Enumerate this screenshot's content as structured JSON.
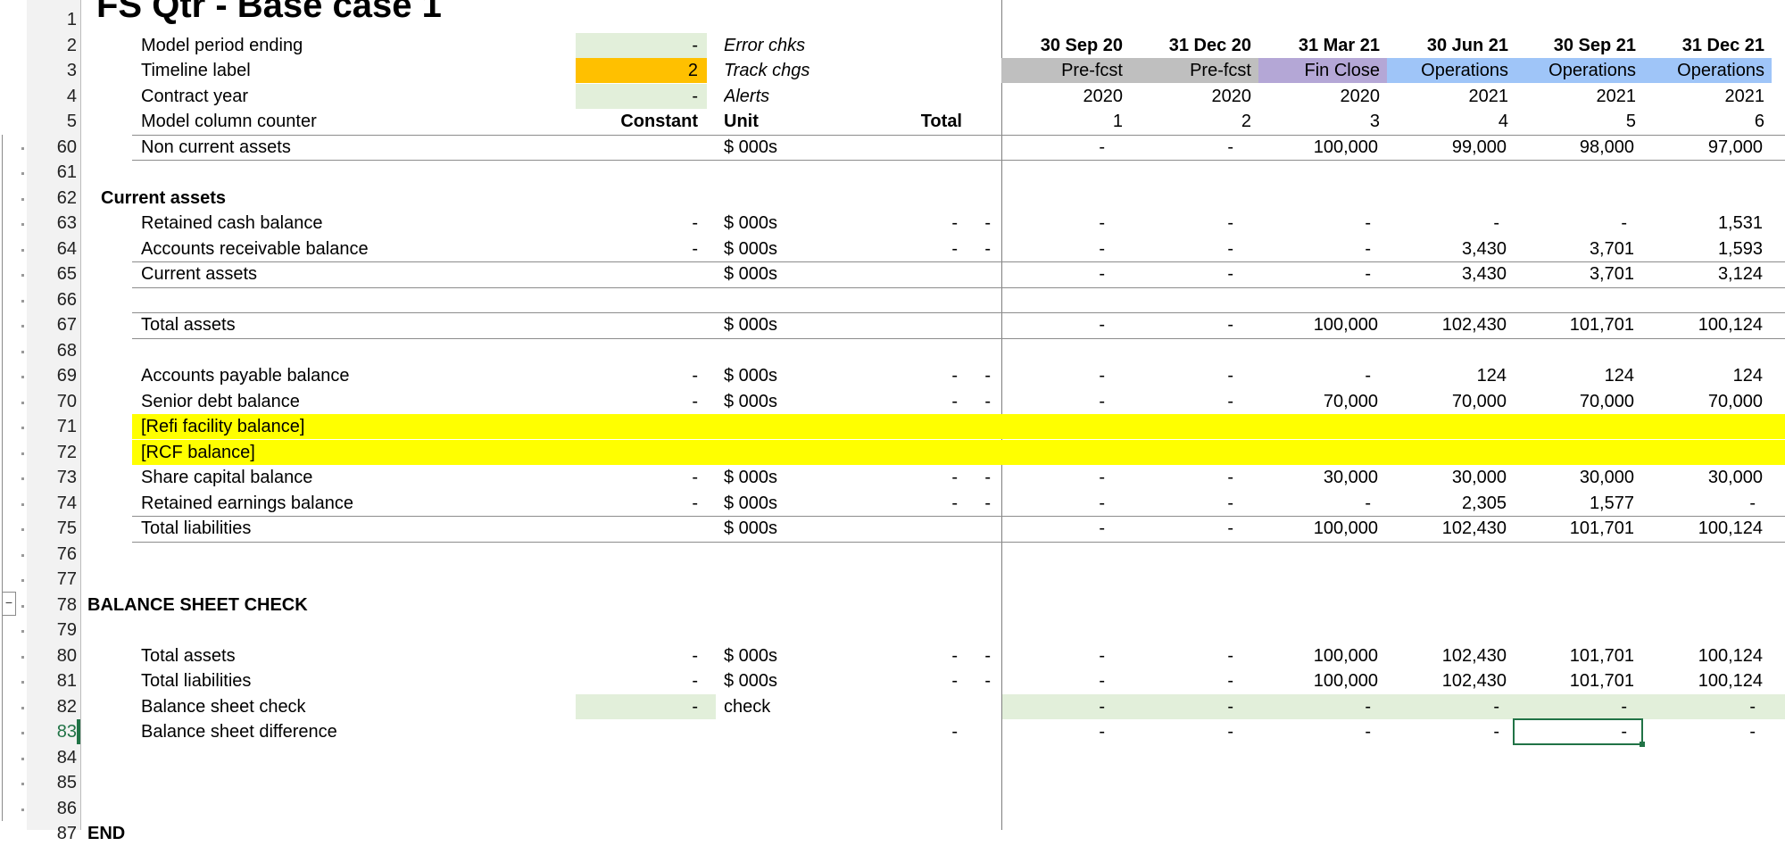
{
  "title": "FS Qtr - Base case 1",
  "header_rows": [
    {
      "row": "2",
      "label": "Model period ending",
      "constant": "-",
      "unit": "Error chks",
      "unit_italic": true,
      "periods": [
        "30 Sep 20",
        "31 Dec 20",
        "31 Mar 21",
        "30 Jun 21",
        "30 Sep 21",
        "31 Dec 21"
      ],
      "bold_periods": true
    },
    {
      "row": "3",
      "label": "Timeline label",
      "constant": "2",
      "unit": "Track chgs",
      "unit_italic": true,
      "periods": [
        "Pre-fcst",
        "Pre-fcst",
        "Fin Close",
        "Operations",
        "Operations",
        "Operations"
      ]
    },
    {
      "row": "4",
      "label": "Contract year",
      "constant": "-",
      "unit": "Alerts",
      "unit_italic": true,
      "periods": [
        "2020",
        "2020",
        "2020",
        "2021",
        "2021",
        "2021"
      ]
    },
    {
      "row": "5",
      "label": "Model column counter",
      "constant": "Constant",
      "unit": "Unit",
      "total": "Total",
      "periods": [
        "1",
        "2",
        "3",
        "4",
        "5",
        "6"
      ]
    }
  ],
  "timeline_colors": {
    "Pre-fcst": "#bfbfbf",
    "Fin Close": "#b4a7d6",
    "Operations": "#9fc5f8"
  },
  "data_rows": [
    {
      "row": "60",
      "label": "Non current assets",
      "indent": 2,
      "unit": "$ 000s",
      "values": [
        "-",
        "-",
        "100,000",
        "99,000",
        "98,000",
        "97,000"
      ]
    },
    {
      "row": "61"
    },
    {
      "row": "62",
      "label": "Current assets",
      "indent": 1,
      "bold": true
    },
    {
      "row": "63",
      "label": "Retained cash balance",
      "indent": 2,
      "constant": "-",
      "unit": "$ 000s",
      "total": "-",
      "flag": "-",
      "values": [
        "-",
        "-",
        "-",
        "-",
        "-",
        "1,531"
      ]
    },
    {
      "row": "64",
      "label": "Accounts receivable balance",
      "indent": 2,
      "constant": "-",
      "unit": "$ 000s",
      "total": "-",
      "flag": "-",
      "values": [
        "-",
        "-",
        "-",
        "3,430",
        "3,701",
        "1,593"
      ]
    },
    {
      "row": "65",
      "label": "Current assets",
      "indent": 2,
      "unit": "$ 000s",
      "values": [
        "-",
        "-",
        "-",
        "3,430",
        "3,701",
        "3,124"
      ]
    },
    {
      "row": "66"
    },
    {
      "row": "67",
      "label": "Total assets",
      "indent": 2,
      "unit": "$ 000s",
      "values": [
        "-",
        "-",
        "100,000",
        "102,430",
        "101,701",
        "100,124"
      ]
    },
    {
      "row": "68"
    },
    {
      "row": "69",
      "label": "Accounts payable balance",
      "indent": 2,
      "constant": "-",
      "unit": "$ 000s",
      "total": "-",
      "flag": "-",
      "values": [
        "-",
        "-",
        "-",
        "124",
        "124",
        "124"
      ]
    },
    {
      "row": "70",
      "label": "Senior debt balance",
      "indent": 2,
      "constant": "-",
      "unit": "$ 000s",
      "total": "-",
      "flag": "-",
      "values": [
        "-",
        "-",
        "70,000",
        "70,000",
        "70,000",
        "70,000"
      ]
    },
    {
      "row": "71",
      "label": "[Refi facility balance]",
      "indent": 2,
      "highlight": true
    },
    {
      "row": "72",
      "label": "[RCF balance]",
      "indent": 2,
      "highlight": true
    },
    {
      "row": "73",
      "label": "Share capital balance",
      "indent": 2,
      "constant": "-",
      "unit": "$ 000s",
      "total": "-",
      "flag": "-",
      "values": [
        "-",
        "-",
        "30,000",
        "30,000",
        "30,000",
        "30,000"
      ]
    },
    {
      "row": "74",
      "label": "Retained earnings balance",
      "indent": 2,
      "constant": "-",
      "unit": "$ 000s",
      "total": "-",
      "flag": "-",
      "values": [
        "-",
        "-",
        "-",
        "2,305",
        "1,577",
        "-"
      ]
    },
    {
      "row": "75",
      "label": "Total liabilities",
      "indent": 2,
      "unit": "$ 000s",
      "values": [
        "-",
        "-",
        "100,000",
        "102,430",
        "101,701",
        "100,124"
      ]
    },
    {
      "row": "76"
    },
    {
      "row": "77"
    },
    {
      "row": "78",
      "label": "BALANCE SHEET CHECK",
      "indent": 0,
      "bold": true
    },
    {
      "row": "79"
    },
    {
      "row": "80",
      "label": "Total assets",
      "indent": 2,
      "constant": "-",
      "unit": "$ 000s",
      "total": "-",
      "flag": "-",
      "values": [
        "-",
        "-",
        "100,000",
        "102,430",
        "101,701",
        "100,124"
      ]
    },
    {
      "row": "81",
      "label": "Total liabilities",
      "indent": 2,
      "constant": "-",
      "unit": "$ 000s",
      "total": "-",
      "flag": "-",
      "values": [
        "-",
        "-",
        "100,000",
        "102,430",
        "101,701",
        "100,124"
      ]
    },
    {
      "row": "82",
      "label": "Balance sheet check",
      "indent": 2,
      "constant": "-",
      "unit": "check",
      "values": [
        "-",
        "-",
        "-",
        "-",
        "-",
        "-"
      ],
      "check": true
    },
    {
      "row": "83",
      "label": "Balance sheet difference",
      "indent": 2,
      "total": "-",
      "values": [
        "-",
        "-",
        "-",
        "-",
        "-",
        "-"
      ],
      "selected_row": true
    },
    {
      "row": "84"
    },
    {
      "row": "85"
    },
    {
      "row": "86"
    },
    {
      "row": "87",
      "label": "END",
      "indent": 0,
      "bold": true
    }
  ],
  "colors": {
    "check_fill": "#e2efda",
    "highlight": "#ffff00",
    "input_orange": "#ffc000",
    "selection": "#217346"
  }
}
